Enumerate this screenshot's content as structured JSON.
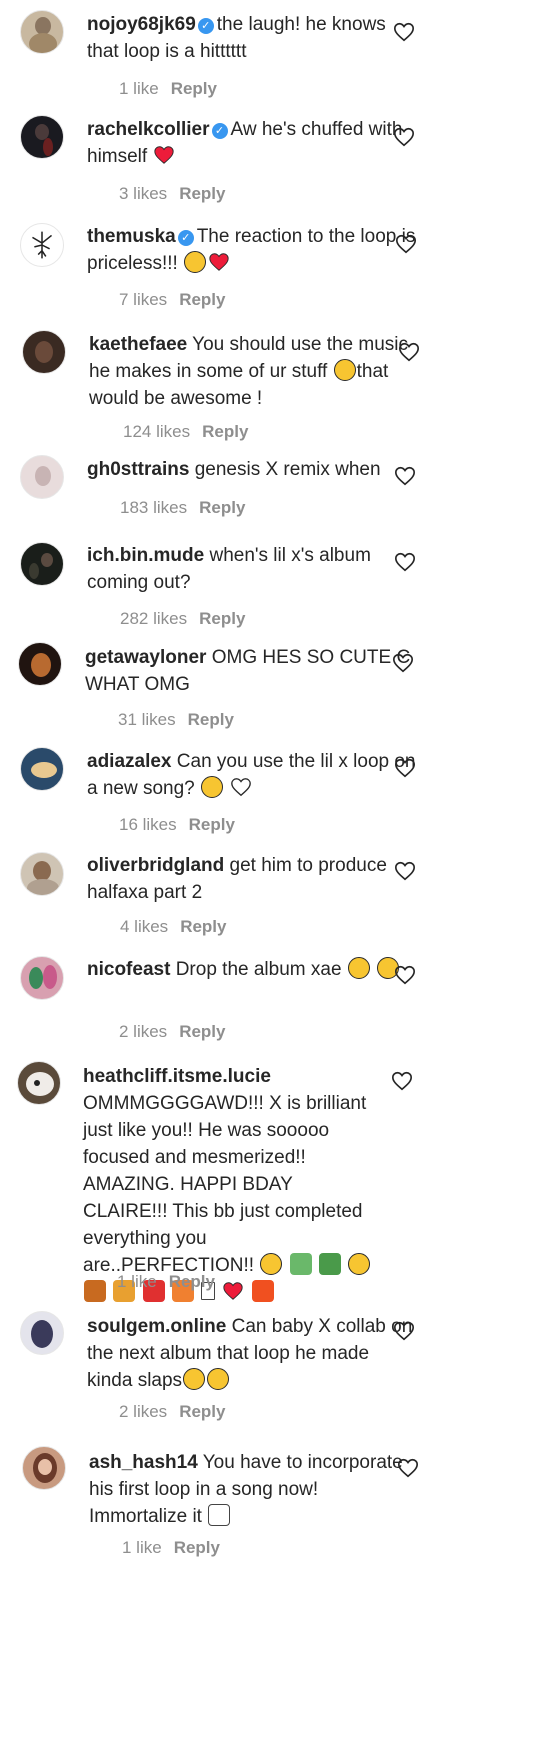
{
  "comments": [
    {
      "username": "nojoy68jk69",
      "verified": true,
      "text": "the laugh! he knows that loop is a hitttttt",
      "likes": "1 like",
      "reply": "Reply"
    },
    {
      "username": "rachelkcollier",
      "verified": true,
      "text": "Aw he's chuffed with himself",
      "emojis": [
        "red-heart"
      ],
      "likes": "3 likes",
      "reply": "Reply"
    },
    {
      "username": "themuska",
      "verified": true,
      "text": "The reaction to the loop is priceless!!!",
      "emojis": [
        "smiling-face",
        "red-heart"
      ],
      "likes": "7 likes",
      "reply": "Reply"
    },
    {
      "username": "kaethefaee",
      "verified": false,
      "text": "You should use the music he makes in some of ur stuff",
      "text2": "that would be awesome !",
      "emojis": [
        "pleading-face"
      ],
      "likes": "124 likes",
      "reply": "Reply"
    },
    {
      "username": "gh0sttrains",
      "verified": false,
      "text": "genesis X remix when",
      "likes": "183 likes",
      "reply": "Reply"
    },
    {
      "username": "ich.bin.mude",
      "verified": false,
      "text": "when's lil x's album coming out?",
      "likes": "282 likes",
      "reply": "Reply"
    },
    {
      "username": "getawayloner",
      "verified": false,
      "text": "OMG HES SO CUTE C WHAT OMG",
      "likes": "31 likes",
      "reply": "Reply"
    },
    {
      "username": "adiazalex",
      "verified": false,
      "text": "Can you use the lil x loop on a new song?",
      "emojis": [
        "thinking-face",
        "white-heart"
      ],
      "likes": "16 likes",
      "reply": "Reply"
    },
    {
      "username": "oliverbridgland",
      "verified": false,
      "text": "get him to produce halfaxa part 2",
      "likes": "4 likes",
      "reply": "Reply"
    },
    {
      "username": "nicofeast",
      "verified": false,
      "text": "Drop the album xae",
      "emojis": [
        "tired-face",
        "tired-face"
      ],
      "likes": "2 likes",
      "reply": "Reply"
    },
    {
      "username": "heathcliff.itsme.lucie",
      "verified": false,
      "text": "OMMMGGGGAWD!!! X is brilliant just like you!! He was sooooo focused and mesmerized!! AMAZING. HAPPI BDAY CLAIRE!!! This bb just completed everything you are..PERFECTION!!",
      "emojis": [
        "smiling-face-with-hearts",
        "person-shrugging",
        "money-bag",
        "raising-hands",
        "butterfly",
        "party-popper",
        "balloon",
        "wrapped-gift",
        "box",
        "red-heart",
        "collision"
      ],
      "likes": "1 like",
      "reply": "Reply"
    },
    {
      "username": "soulgem.online",
      "verified": false,
      "text": "Can baby X collab on the next album that loop he made kinda slaps",
      "emojis": [
        "grimacing-face",
        "grimacing-face"
      ],
      "likes": "2 likes",
      "reply": "Reply"
    },
    {
      "username": "ash_hash14",
      "verified": false,
      "text": "You have to incorporate his first loop in a song now! Immortalize it",
      "emojis": [
        "unicorn"
      ],
      "likes": "1 like",
      "reply": "Reply"
    }
  ],
  "colors": {
    "text": "#262626",
    "meta": "#8e8e8e",
    "verified": "#3897f0",
    "heart": "#ed1c3a"
  }
}
